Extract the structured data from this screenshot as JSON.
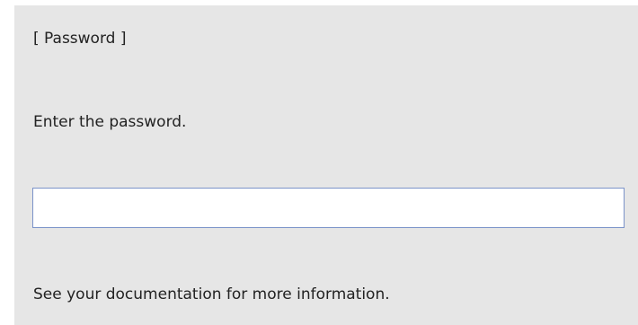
{
  "dialog": {
    "title": "[ Password ]",
    "prompt": "Enter the password.",
    "password_value": "",
    "footer_text": "See your documentation for more information."
  },
  "colors": {
    "panel_background": "#e6e6e6",
    "input_border": "#7b93c9",
    "text": "#222222"
  }
}
